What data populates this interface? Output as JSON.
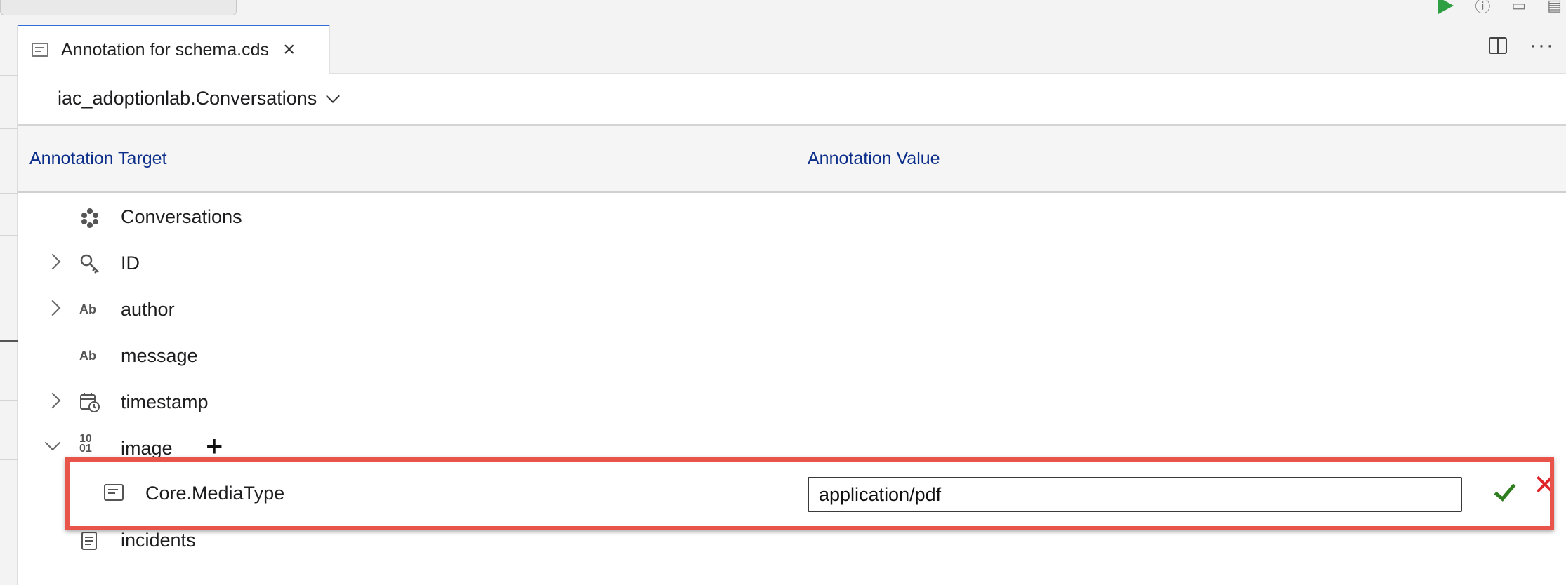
{
  "tab": {
    "title": "Annotation for schema.cds",
    "close_glyph": "×",
    "more_glyph": "···"
  },
  "entity_selector": {
    "label": "iac_adoptionlab.Conversations"
  },
  "table": {
    "headers": {
      "target": "Annotation Target",
      "value": "Annotation Value"
    },
    "rows": [
      {
        "label": "Conversations",
        "icon": "entity-cube-icon",
        "expandable": false
      },
      {
        "label": "ID",
        "icon": "key-icon",
        "expandable": true
      },
      {
        "label": "author",
        "icon": "string-type-icon",
        "expandable": true
      },
      {
        "label": "message",
        "icon": "string-type-icon",
        "expandable": false
      },
      {
        "label": "timestamp",
        "icon": "calendar-clock-icon",
        "expandable": true
      },
      {
        "label": "image",
        "icon": "binary-type-icon",
        "expandable": true,
        "expanded": true
      },
      {
        "label": "incidents",
        "icon": "association-icon",
        "expandable": false
      }
    ],
    "type_glyphs": {
      "string": "Ab",
      "binary_top": "10",
      "binary_bottom": "01"
    },
    "add_glyph": "+"
  },
  "annotation_edit": {
    "label": "Core.MediaType",
    "value": "application/pdf",
    "confirm_icon": "checkmark-icon",
    "cancel_icon": "x-icon",
    "cancel_glyph": "✕"
  },
  "colors": {
    "header_text": "#0b2e8a",
    "highlight_border": "#e8534a",
    "confirm": "#2e7d1e",
    "cancel": "#e0252a",
    "active_tab_border": "#2f6fd6"
  }
}
